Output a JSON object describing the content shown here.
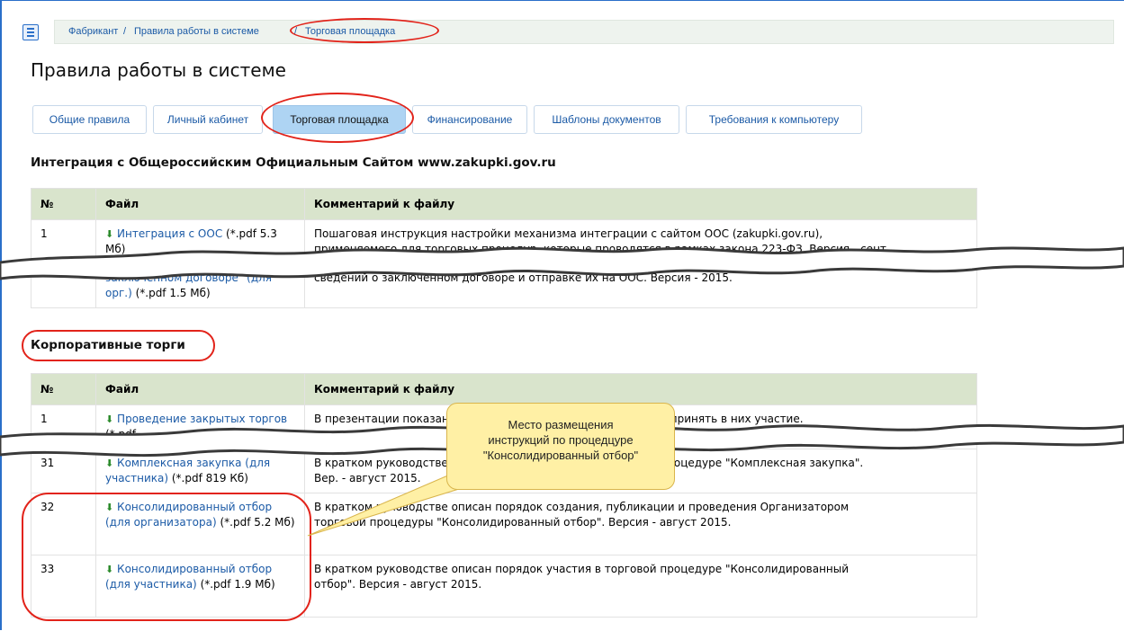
{
  "breadcrumb": {
    "home": "Фабрикант",
    "sep1": " / ",
    "section": "Правила работы в системе",
    "sep2": " / ",
    "current": "Торговая площадка"
  },
  "page": {
    "title": "Правила работы в системе"
  },
  "tabs": [
    {
      "label": "Общие правила"
    },
    {
      "label": "Личный кабинет"
    },
    {
      "label": "Торговая площадка"
    },
    {
      "label": "Финансирование"
    },
    {
      "label": "Шаблоны документов"
    },
    {
      "label": "Требования к компьютеру"
    }
  ],
  "section1": {
    "heading": "Интеграция с Общероссийским Официальным Сайтом www.zakupki.gov.ru",
    "headers": {
      "num": "№",
      "file": "Файл",
      "comment": "Комментарий к файлу"
    },
    "row1": {
      "num": "1",
      "link": "Интеграция с ООС",
      "meta": " (*.pdf 5.3 Мб)",
      "comment_line1": "Пошаговая инструкция настройки механизма интеграции с сайтом ООС (zakupki.gov.ru),",
      "comment_line2": "применяемого для торговых процедур, которые проводятся в рамках закона 223-ФЗ. Версия - сент."
    },
    "row2": {
      "link": "заключенном договоре\" (для орг.)",
      "meta": " (*.pdf 1.5 Мб)",
      "comment": "сведений о заключенном договоре и отправке их на ООС. Версия - 2015."
    }
  },
  "section2": {
    "heading": "Корпоративные торги",
    "headers": {
      "num": "№",
      "file": "Файл",
      "comment": "Комментарий к файлу"
    },
    "row1": {
      "num": "1",
      "link": "Проведение закрытых торгов",
      "meta": " (*.pdf",
      "comment": "В презентации показано, как провести закрытые торги и как принять в них участие."
    },
    "row31": {
      "num": "31",
      "link": "Комплексная закупка (для участника)",
      "meta": " (*.pdf 819 Кб)",
      "comment_line1": "В кратком руководстве описан порядок участия в торговой процедуре \"Комплексная закупка\".",
      "comment_line2": "Вер. - август 2015."
    },
    "row32": {
      "num": "32",
      "link": "Консолидированный отбор (для организатора)",
      "meta": " (*.pdf 5.2 Мб)",
      "comment_line1": "В кратком руководстве описан порядок создания, публикации и проведения Организатором",
      "comment_line2": "торговой процедуры \"Консолидированный отбор\". Версия - август 2015."
    },
    "row33": {
      "num": "33",
      "link": "Консолидированный отбор (для участника)",
      "meta": " (*.pdf 1.9 Мб)",
      "comment_line1": "В кратком руководстве описан порядок участия в торговой процедуре \"Консолидированный",
      "comment_line2": "отбор\". Версия - август 2015."
    }
  },
  "callout": {
    "line1": "Место размещения",
    "line2": "инструкций по процедцуре",
    "line3": "\"Консолидированный отбор\""
  },
  "icons": {
    "menu": "list-icon",
    "download": "download-arrow-icon"
  },
  "colors": {
    "link": "#1b5aa6",
    "table_header": "#d9e4cc",
    "active_tab": "#aed4f3",
    "annotation": "#e2231a",
    "callout_bg": "#fff0a5"
  }
}
